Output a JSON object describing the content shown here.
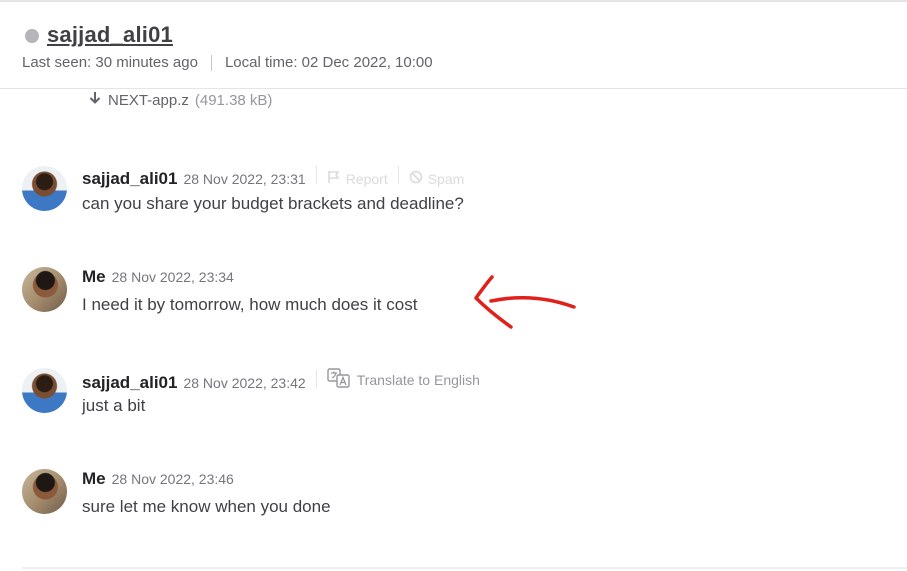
{
  "header": {
    "username": "sajjad_ali01",
    "last_seen": "Last seen: 30 minutes ago",
    "local_time": "Local time: 02 Dec 2022, 10:00"
  },
  "attachment": {
    "file_name": "NEXT-app.z",
    "file_size": "(491.38 kB)"
  },
  "messages": [
    {
      "sender": "sajjad_ali01",
      "time": "28 Nov 2022, 23:31",
      "text": "can you share your budget brackets and deadline?",
      "report_label": "Report",
      "spam_label": "Spam"
    },
    {
      "sender": "Me",
      "time": "28 Nov 2022, 23:34",
      "text": "I need it by tomorrow, how much does it cost"
    },
    {
      "sender": "sajjad_ali01",
      "time": "28 Nov 2022, 23:42",
      "text": "just a bit",
      "translate_label": "Translate to English"
    },
    {
      "sender": "Me",
      "time": "28 Nov 2022, 23:46",
      "text": "sure let me know when you done"
    }
  ],
  "colors": {
    "annotation_arrow": "#e0201b",
    "status_dot": "#b5b6ba"
  },
  "icons": [
    "download-icon",
    "flag-icon",
    "spam-icon",
    "translate-icon",
    "status-dot"
  ]
}
